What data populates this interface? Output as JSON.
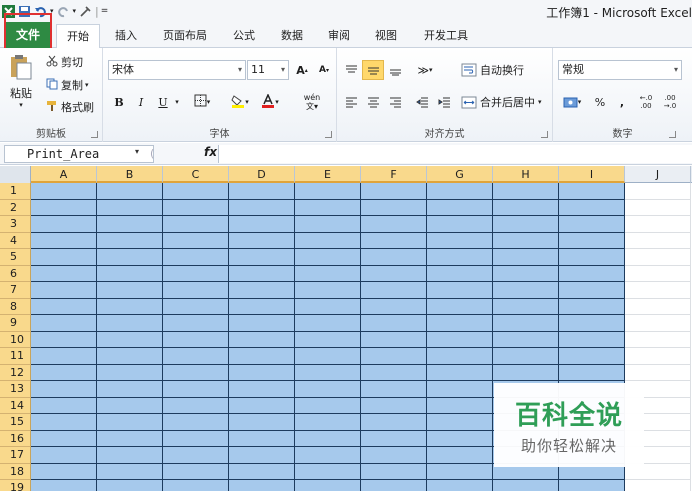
{
  "window": {
    "title": "工作簿1 - Microsoft Excel"
  },
  "tabs": [
    "文件",
    "开始",
    "插入",
    "页面布局",
    "公式",
    "数据",
    "审阅",
    "视图",
    "开发工具"
  ],
  "clipboard": {
    "paste": "粘贴",
    "cut": "剪切",
    "copy": "复制",
    "format_painter": "格式刷",
    "label": "剪贴板"
  },
  "font": {
    "name": "宋体",
    "size": "11",
    "bold": "B",
    "italic": "I",
    "underline": "U",
    "grow": "A",
    "shrink": "A",
    "phonetic": "wén",
    "label": "字体"
  },
  "alignment": {
    "wrap": "自动换行",
    "merge": "合并后居中",
    "label": "对齐方式"
  },
  "number": {
    "format": "常规",
    "percent": "%",
    "comma": ",",
    "inc_decimal": ".00",
    "dec_decimal": ".00",
    "label": "数字"
  },
  "formula_bar": {
    "name_box": "Print_Area",
    "fx": "fx",
    "value": ""
  },
  "sheet": {
    "columns": [
      "A",
      "B",
      "C",
      "D",
      "E",
      "F",
      "G",
      "H",
      "I",
      "J"
    ],
    "rows": [
      "1",
      "2",
      "3",
      "4",
      "5",
      "6",
      "7",
      "8",
      "9",
      "10",
      "11",
      "12",
      "13",
      "14",
      "15",
      "16",
      "17",
      "18",
      "19"
    ],
    "selected_fill": "#a6c9ec",
    "selected_range": "A1:I19"
  },
  "watermark": {
    "title": "百科全说",
    "subtitle": "助你轻松解决"
  },
  "colors": {
    "file_tab": "#2e8a43",
    "highlight_box": "#e03030",
    "watermark_green": "#2f9e57"
  }
}
